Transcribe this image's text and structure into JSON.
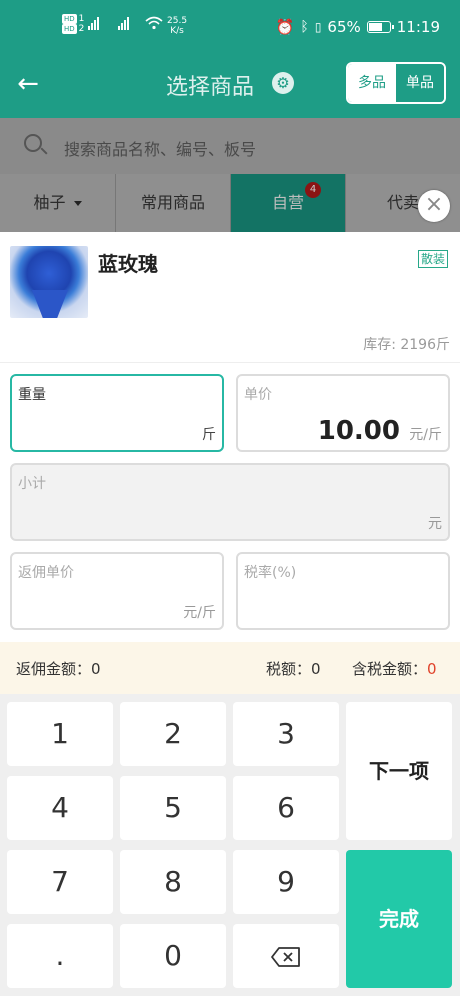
{
  "status_bar": {
    "speed_value": "25.5",
    "speed_unit": "K/s",
    "battery": "65%",
    "time": "11:19"
  },
  "header": {
    "title": "选择商品",
    "mode_multi": "多品",
    "mode_single": "单品"
  },
  "search": {
    "placeholder": "搜索商品名称、编号、板号"
  },
  "tabs": [
    {
      "label": "柚子"
    },
    {
      "label": "常用商品"
    },
    {
      "label": "自营",
      "badge": "4"
    },
    {
      "label": "代卖"
    }
  ],
  "product": {
    "name": "蓝玫瑰",
    "tag": "散装",
    "stock": "库存: 2196斤"
  },
  "fields": {
    "weight": {
      "label": "重量",
      "unit": "斤"
    },
    "unit_price": {
      "label": "单价",
      "value": "10.00",
      "unit": "元/斤"
    },
    "subtotal": {
      "label": "小计",
      "unit": "元"
    },
    "rebate_price": {
      "label": "返佣单价",
      "unit": "元/斤"
    },
    "tax_rate": {
      "label": "税率(%)"
    }
  },
  "summary": {
    "rebate_amount": "返佣金额：0",
    "tax_amount": "税额：0",
    "tax_included_label": "含税金额：",
    "tax_included_value": "0"
  },
  "keypad": {
    "k1": "1",
    "k2": "2",
    "k3": "3",
    "k4": "4",
    "k5": "5",
    "k6": "6",
    "k7": "7",
    "k8": "8",
    "k9": "9",
    "dot": ".",
    "k0": "0",
    "next": "下一项",
    "done": "完成"
  }
}
